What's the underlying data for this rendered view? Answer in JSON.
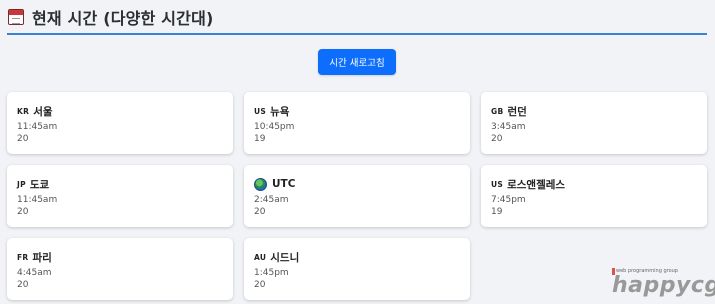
{
  "header": {
    "title": "현재 시간 (다양한 시간대)",
    "icon": "calendar-icon"
  },
  "refresh_button": {
    "label": "시간 새로고침"
  },
  "cards": [
    {
      "country": "KR",
      "city": "서울",
      "time": "11:45am",
      "day": "20"
    },
    {
      "country": "US",
      "city": "뉴욕",
      "time": "10:45pm",
      "day": "19"
    },
    {
      "country": "GB",
      "city": "런던",
      "time": "3:45am",
      "day": "20"
    },
    {
      "country": "JP",
      "city": "도쿄",
      "time": "11:45am",
      "day": "20"
    },
    {
      "country": "",
      "city": "UTC",
      "time": "2:45am",
      "day": "20",
      "icon": "globe-icon"
    },
    {
      "country": "US",
      "city": "로스앤젤레스",
      "time": "7:45pm",
      "day": "19"
    },
    {
      "country": "FR",
      "city": "파리",
      "time": "4:45am",
      "day": "20"
    },
    {
      "country": "AU",
      "city": "시드니",
      "time": "1:45pm",
      "day": "20"
    }
  ],
  "watermark": {
    "small": "web programming group",
    "big": "happycgi"
  },
  "colors": {
    "accent": "#0d6efd",
    "header_rule": "#3b82d6",
    "background": "#f1f3f6"
  }
}
